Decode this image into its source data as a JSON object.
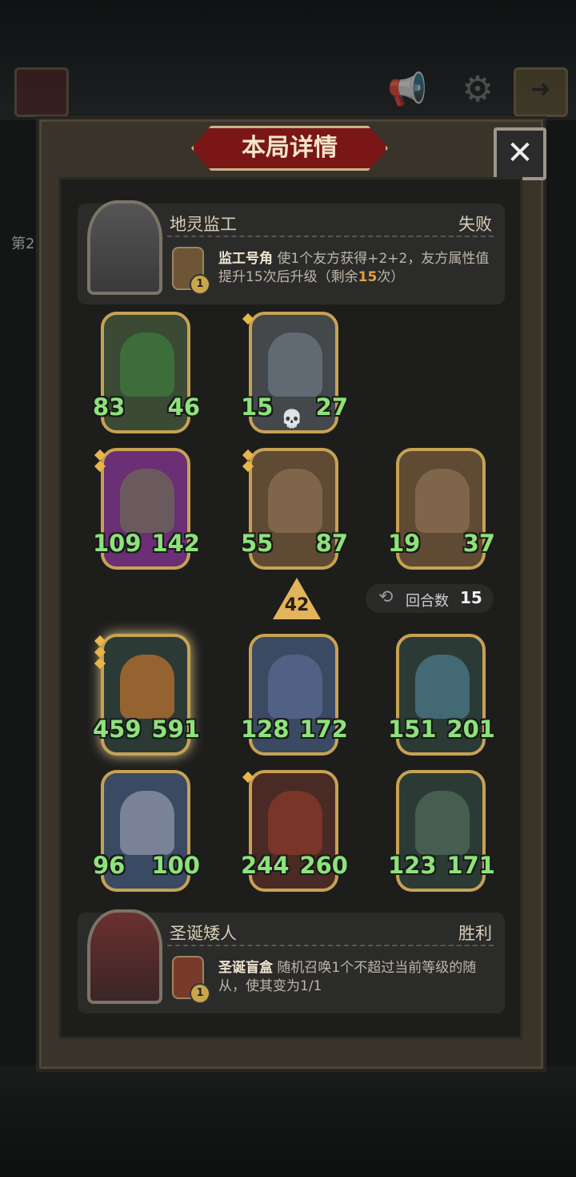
{
  "panel": {
    "title": "本局详情",
    "close_label": "✕"
  },
  "hud": {
    "side_label": "第2"
  },
  "opponent": {
    "name": "地灵监工",
    "result": "失败",
    "skill_name": "监工号角",
    "skill_desc_pre": "使1个友方获得+2+2，友方属性值提升15次后升级（剩余",
    "skill_highlight": "15",
    "skill_desc_post": "次）",
    "skill_badge": "1"
  },
  "opponent_board": [
    {
      "attack": "83",
      "health": "46"
    },
    {
      "attack": "15",
      "health": "27"
    },
    {
      "attack": "109",
      "health": "142"
    },
    {
      "attack": "55",
      "health": "87"
    },
    {
      "attack": "19",
      "health": "37"
    }
  ],
  "level": "42",
  "rounds": {
    "label": "回合数",
    "value": "15"
  },
  "player_board": [
    {
      "attack": "459",
      "health": "591"
    },
    {
      "attack": "128",
      "health": "172"
    },
    {
      "attack": "151",
      "health": "201"
    },
    {
      "attack": "96",
      "health": "100"
    },
    {
      "attack": "244",
      "health": "260"
    },
    {
      "attack": "123",
      "health": "171"
    }
  ],
  "player": {
    "name": "圣诞矮人",
    "result": "胜利",
    "skill_name": "圣诞盲盒",
    "skill_desc": "随机召唤1个不超过当前等级的随从，使其变为1/1",
    "skill_badge": "1"
  }
}
